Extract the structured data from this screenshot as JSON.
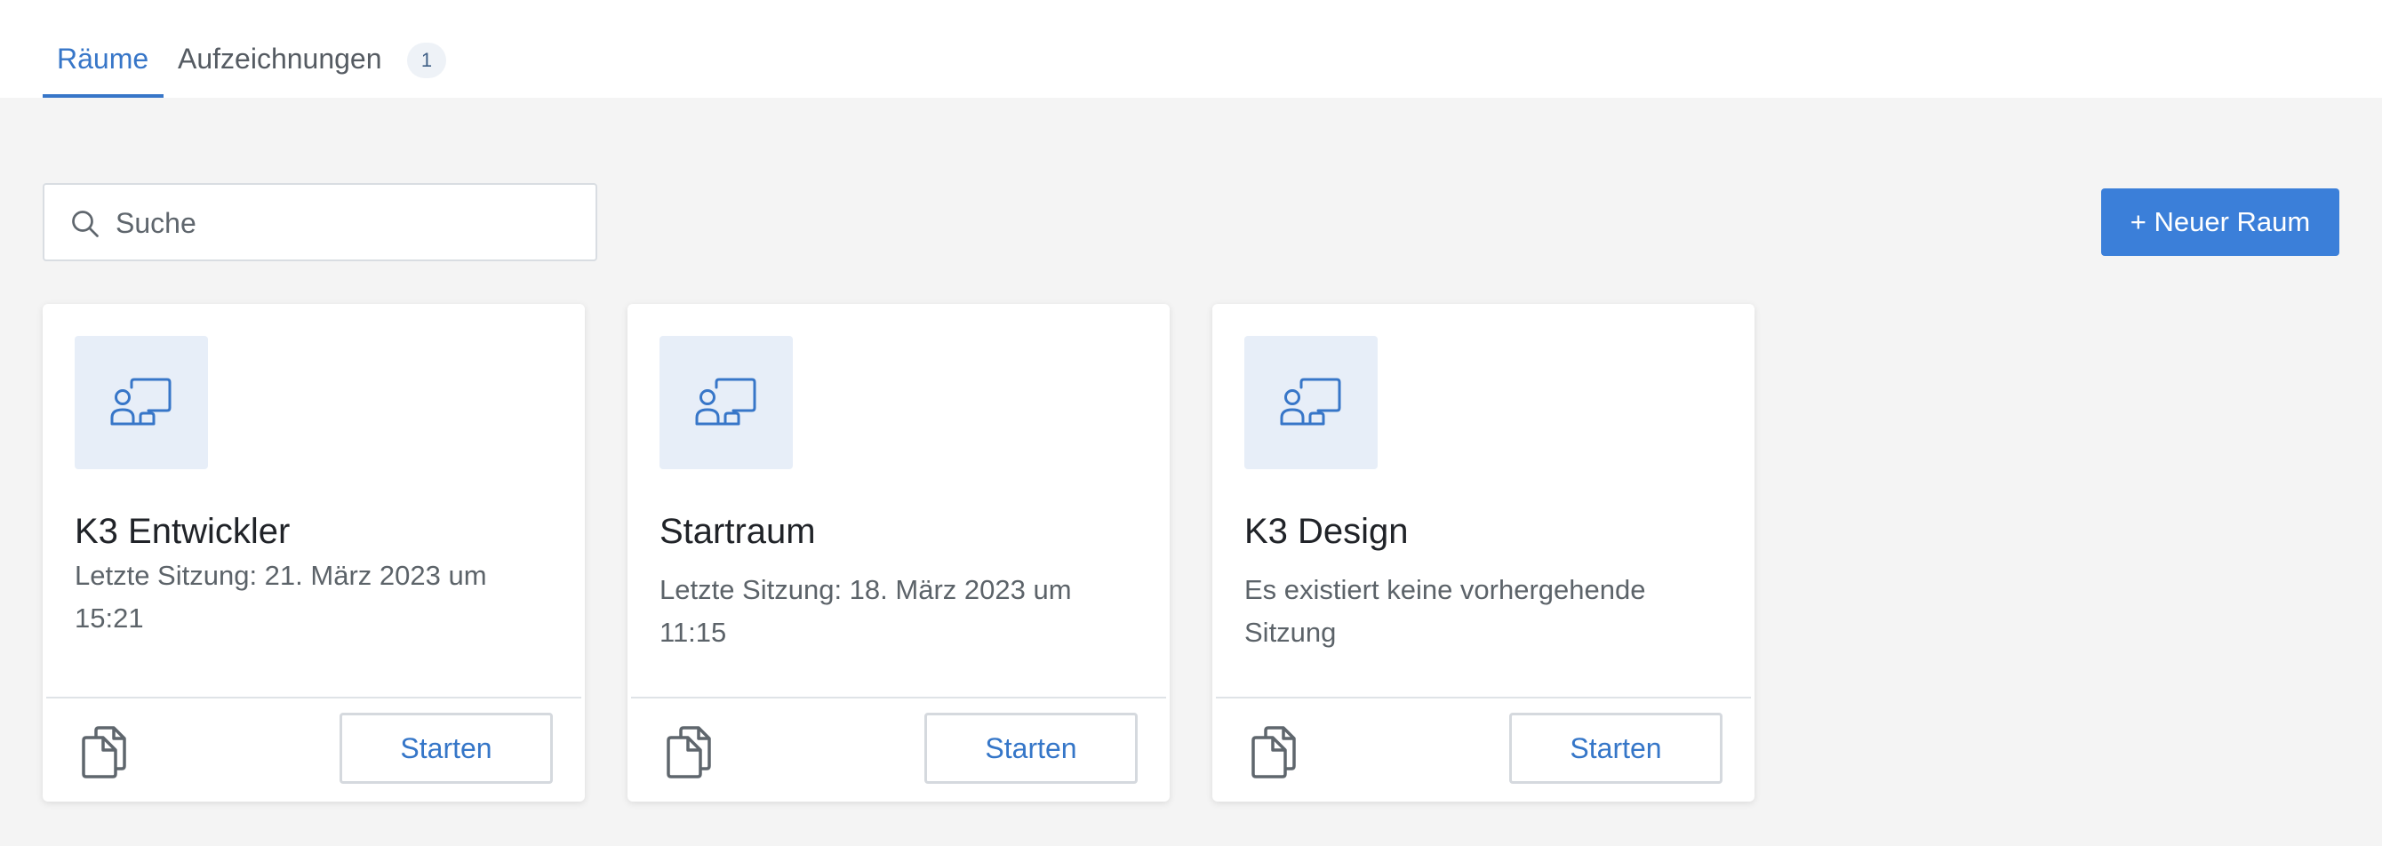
{
  "tabs": {
    "rooms": "Räume",
    "recordings": "Aufzeichnungen",
    "recordings_count": "1"
  },
  "toolbar": {
    "search_placeholder": "Suche",
    "new_room_label": "+ Neuer Raum"
  },
  "rooms": [
    {
      "name": "K3 Entwickler",
      "meta": "Letzte Sitzung: 21. März 2023 um 15:21",
      "start_label": "Starten",
      "icon": "presentation-room-icon"
    },
    {
      "name": "Startraum",
      "meta": "Letzte Sitzung: 18. März 2023 um 11:15",
      "start_label": "Starten",
      "icon": "presentation-room-icon"
    },
    {
      "name": "K3 Design",
      "meta": "Es existiert keine vorhergehende Sitzung",
      "start_label": "Starten",
      "icon": "presentation-room-icon"
    }
  ],
  "colors": {
    "accent": "#3776c8",
    "button_primary": "#3b7fd9",
    "page_background": "#f4f4f4",
    "thumbnail_background": "#e7eef8"
  },
  "icons": {
    "search": "search-icon",
    "copy": "copy-icon"
  }
}
